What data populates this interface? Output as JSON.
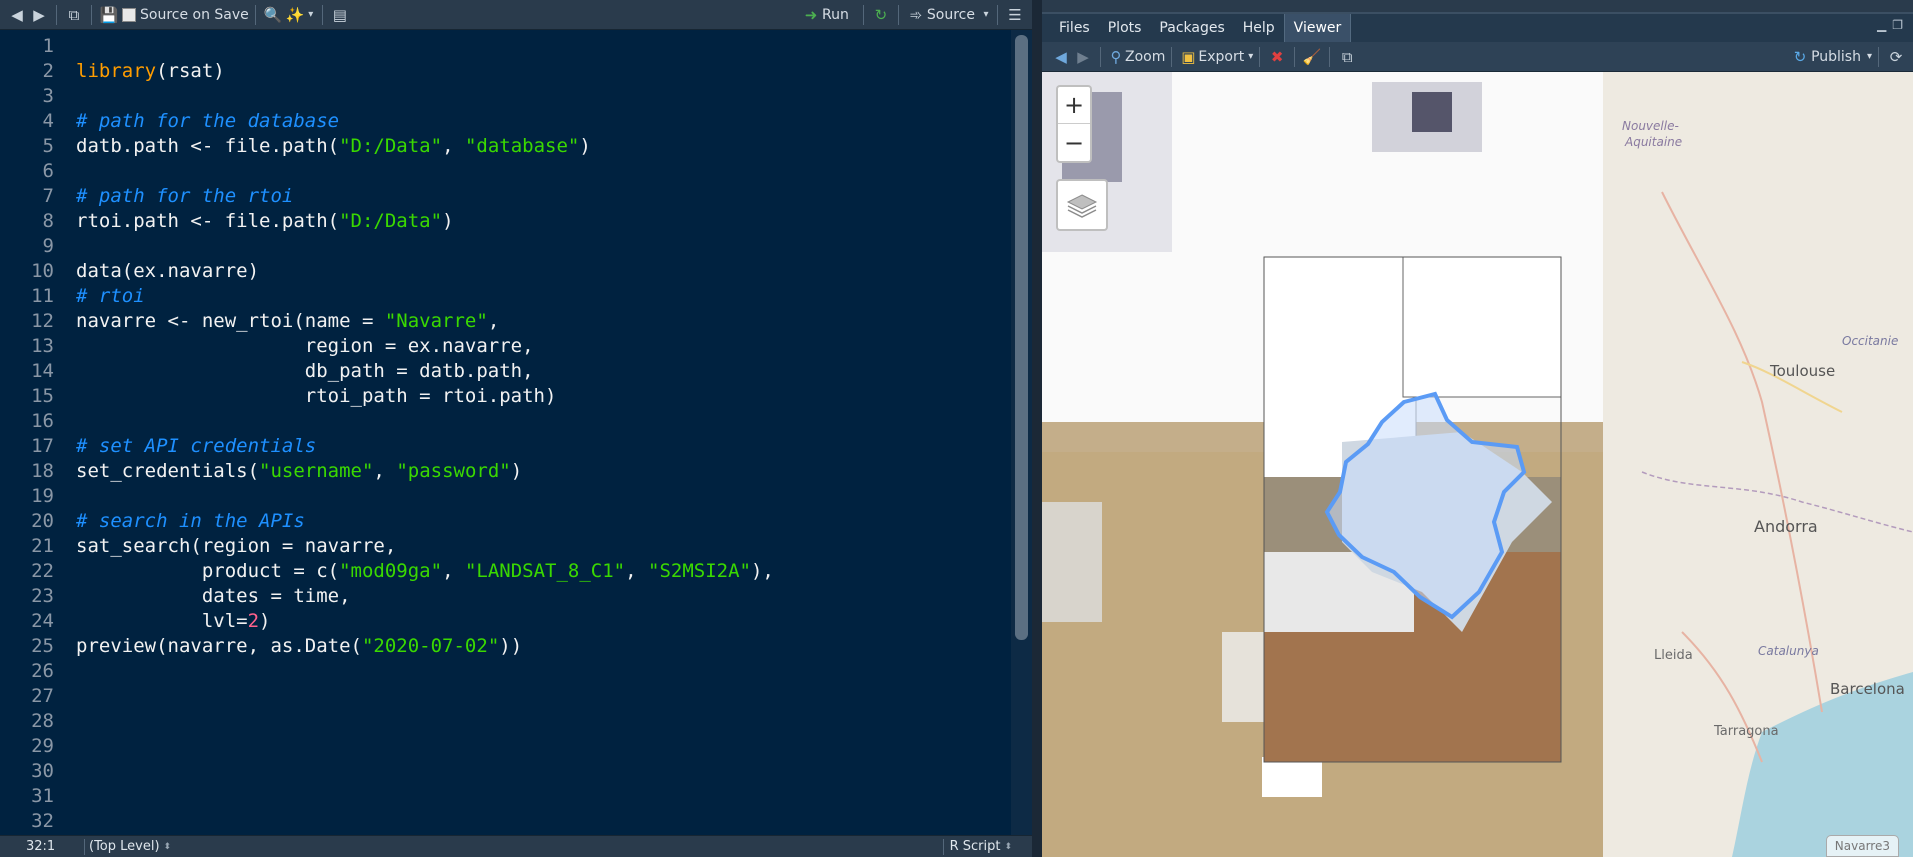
{
  "editor": {
    "toolbar": {
      "source_on_save": "Source on Save",
      "run": "Run",
      "source": "Source"
    },
    "lines": [
      {
        "n": "1",
        "tokens": []
      },
      {
        "n": "2",
        "tokens": [
          {
            "c": "kw",
            "t": "library"
          },
          {
            "c": "plain",
            "t": "(rsat)"
          }
        ]
      },
      {
        "n": "3",
        "tokens": []
      },
      {
        "n": "4",
        "tokens": [
          {
            "c": "cmt",
            "t": "# path for the database"
          }
        ]
      },
      {
        "n": "5",
        "tokens": [
          {
            "c": "plain",
            "t": "datb.path <- file.path("
          },
          {
            "c": "str",
            "t": "\"D:/Data\""
          },
          {
            "c": "plain",
            "t": ", "
          },
          {
            "c": "str",
            "t": "\"database\""
          },
          {
            "c": "plain",
            "t": ")"
          }
        ]
      },
      {
        "n": "6",
        "tokens": []
      },
      {
        "n": "7",
        "tokens": [
          {
            "c": "cmt",
            "t": "# path for the rtoi"
          }
        ]
      },
      {
        "n": "8",
        "tokens": [
          {
            "c": "plain",
            "t": "rtoi.path <- file.path("
          },
          {
            "c": "str",
            "t": "\"D:/Data\""
          },
          {
            "c": "plain",
            "t": ")"
          }
        ]
      },
      {
        "n": "9",
        "tokens": []
      },
      {
        "n": "10",
        "tokens": [
          {
            "c": "plain",
            "t": "data(ex.navarre)"
          }
        ]
      },
      {
        "n": "11",
        "tokens": [
          {
            "c": "cmt",
            "t": "# rtoi"
          }
        ]
      },
      {
        "n": "12",
        "tokens": [
          {
            "c": "plain",
            "t": "navarre <- new_rtoi(name = "
          },
          {
            "c": "str",
            "t": "\"Navarre\""
          },
          {
            "c": "plain",
            "t": ","
          }
        ]
      },
      {
        "n": "13",
        "tokens": [
          {
            "c": "plain",
            "t": "                    region = ex.navarre,"
          }
        ]
      },
      {
        "n": "14",
        "tokens": [
          {
            "c": "plain",
            "t": "                    db_path = datb.path,"
          }
        ]
      },
      {
        "n": "15",
        "tokens": [
          {
            "c": "plain",
            "t": "                    rtoi_path = rtoi.path)"
          }
        ]
      },
      {
        "n": "16",
        "tokens": []
      },
      {
        "n": "17",
        "tokens": [
          {
            "c": "cmt",
            "t": "# set API credentials"
          }
        ]
      },
      {
        "n": "18",
        "tokens": [
          {
            "c": "plain",
            "t": "set_credentials("
          },
          {
            "c": "str",
            "t": "\"username\""
          },
          {
            "c": "plain",
            "t": ", "
          },
          {
            "c": "str",
            "t": "\"password\""
          },
          {
            "c": "plain",
            "t": ")"
          }
        ]
      },
      {
        "n": "19",
        "tokens": []
      },
      {
        "n": "20",
        "tokens": [
          {
            "c": "cmt",
            "t": "# search in the APIs"
          }
        ]
      },
      {
        "n": "21",
        "tokens": [
          {
            "c": "plain",
            "t": "sat_search(region = navarre,"
          }
        ]
      },
      {
        "n": "22",
        "tokens": [
          {
            "c": "plain",
            "t": "           product = c("
          },
          {
            "c": "str",
            "t": "\"mod09ga\""
          },
          {
            "c": "plain",
            "t": ", "
          },
          {
            "c": "str",
            "t": "\"LANDSAT_8_C1\""
          },
          {
            "c": "plain",
            "t": ", "
          },
          {
            "c": "str",
            "t": "\"S2MSI2A\""
          },
          {
            "c": "plain",
            "t": "),"
          }
        ]
      },
      {
        "n": "23",
        "tokens": [
          {
            "c": "plain",
            "t": "           dates = time,"
          }
        ]
      },
      {
        "n": "24",
        "tokens": [
          {
            "c": "plain",
            "t": "           lvl="
          },
          {
            "c": "num",
            "t": "2"
          },
          {
            "c": "plain",
            "t": ")"
          }
        ]
      },
      {
        "n": "25",
        "tokens": [
          {
            "c": "plain",
            "t": "preview(navarre, as.Date("
          },
          {
            "c": "str",
            "t": "\"2020-07-02\""
          },
          {
            "c": "plain",
            "t": "))"
          }
        ]
      },
      {
        "n": "26",
        "tokens": []
      },
      {
        "n": "27",
        "tokens": []
      },
      {
        "n": "28",
        "tokens": []
      },
      {
        "n": "29",
        "tokens": []
      },
      {
        "n": "30",
        "tokens": []
      },
      {
        "n": "31",
        "tokens": []
      },
      {
        "n": "32",
        "tokens": []
      }
    ],
    "status": {
      "position": "32:1",
      "scope": "(Top Level)",
      "filetype": "R Script"
    }
  },
  "viewer": {
    "tabs": [
      "Files",
      "Plots",
      "Packages",
      "Help",
      "Viewer"
    ],
    "active_tab": "Viewer",
    "toolbar": {
      "zoom": "Zoom",
      "export": "Export",
      "publish": "Publish"
    },
    "map": {
      "zoom_in": "+",
      "zoom_out": "−",
      "labels": {
        "nouvelle_aquitaine": "Nouvelle-\nAquitaine",
        "toulouse": "Toulouse",
        "occitanie": "Occitanie",
        "andorra": "Andorra",
        "lleida": "Lleida",
        "catalunya": "Catalunya",
        "barcelona": "Barcelona",
        "tarragona": "Tarragona"
      },
      "region_tag": "Navarre3",
      "colors": {
        "region_outline": "#5b9bf5",
        "region_fill": "#c9dcfb"
      }
    }
  }
}
